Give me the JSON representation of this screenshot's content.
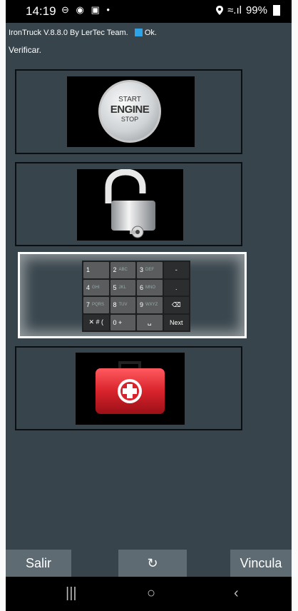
{
  "status_bar": {
    "time": "14:19",
    "left_icons": "⊖ ◉ ▣ •",
    "location_icon": "location-pin-icon",
    "wifi_signal": "≈.ıl",
    "battery": "99%"
  },
  "app": {
    "info_line": "IronTruck  V.8.8.0   By LerTec Team.",
    "connection_status": "Ok.",
    "verify_text": "Verificar."
  },
  "cards": {
    "engine": {
      "top": "START",
      "middle": "ENGINE",
      "bottom": "STOP"
    },
    "keypad": {
      "keys": [
        {
          "main": "1",
          "sub": ""
        },
        {
          "main": "2",
          "sub": "ABC"
        },
        {
          "main": "3",
          "sub": "DEF"
        },
        {
          "main": "-",
          "sub": ""
        },
        {
          "main": "4",
          "sub": "GHI"
        },
        {
          "main": "5",
          "sub": "JKL"
        },
        {
          "main": "6",
          "sub": "MNO"
        },
        {
          "main": ".",
          "sub": ""
        },
        {
          "main": "7",
          "sub": "PQRS"
        },
        {
          "main": "8",
          "sub": "TUV"
        },
        {
          "main": "9",
          "sub": "WXYZ"
        },
        {
          "main": "⌫",
          "sub": ""
        },
        {
          "main": "✕ # (",
          "sub": ""
        },
        {
          "main": "0 +",
          "sub": ""
        },
        {
          "main": "␣",
          "sub": ""
        },
        {
          "main": "Next",
          "sub": ""
        }
      ]
    }
  },
  "buttons": {
    "salir": "Salir",
    "refresh": "↻",
    "vincula": "Vincula"
  },
  "nav": {
    "recents": "|||",
    "home": "○",
    "back": "‹"
  },
  "colors": {
    "background": "#37444b",
    "button": "#5e6b72",
    "firstaid_red": "#d9232c"
  }
}
